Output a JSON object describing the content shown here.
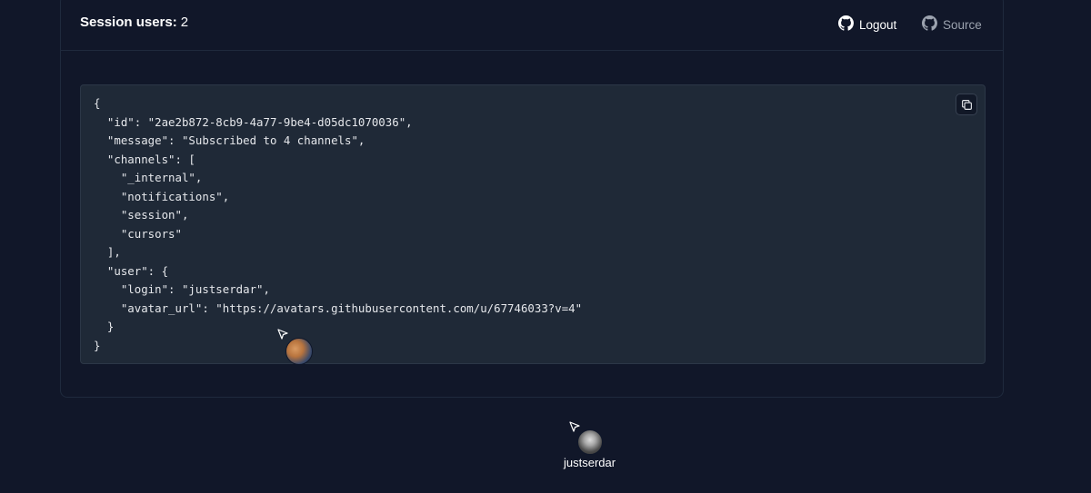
{
  "header": {
    "session_label": "Session users:",
    "session_count": "2",
    "logout_label": "Logout",
    "source_label": "Source"
  },
  "code_block": {
    "content": "{\n  \"id\": \"2ae2b872-8cb9-4a77-9be4-d05dc1070036\",\n  \"message\": \"Subscribed to 4 channels\",\n  \"channels\": [\n    \"_internal\",\n    \"notifications\",\n    \"session\",\n    \"cursors\"\n  ],\n  \"user\": {\n    \"login\": \"justserdar\",\n    \"avatar_url\": \"https://avatars.githubusercontent.com/u/67746033?v=4\"\n  }\n}",
    "copy_icon": "copy-icon"
  },
  "presence": {
    "local_user_name": "justserdar"
  },
  "icons": {
    "logout": "github-icon",
    "source": "github-icon",
    "cursor": "cursor-arrow-icon"
  },
  "colors": {
    "background": "#111729",
    "code_background": "#1f2937",
    "muted_text": "#9ca3af"
  }
}
